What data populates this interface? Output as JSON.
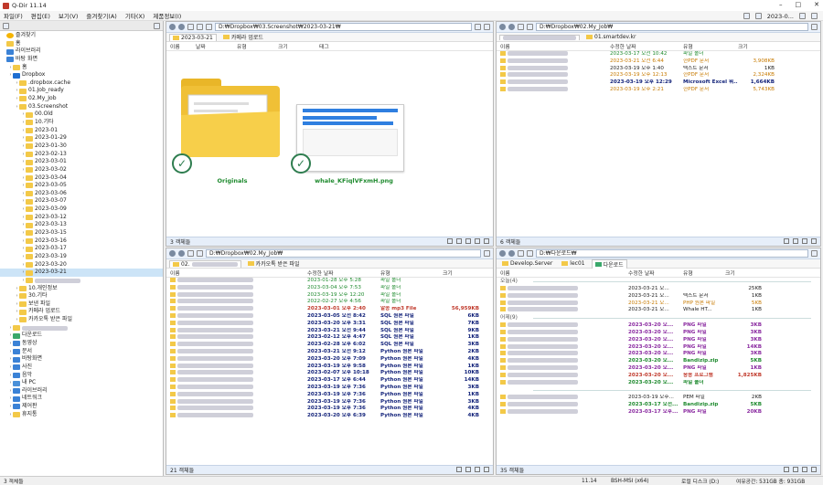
{
  "app": {
    "title": "Q-Dir 11.14"
  },
  "menu": [
    "파일(F)",
    "편집(E)",
    "보기(V)",
    "즐겨찾기(A)",
    "기타(X)",
    "제품정보(I)"
  ],
  "menu_right": {
    "date_label": "2023-0..."
  },
  "tree": [
    {
      "label": "즐겨찾기",
      "indent": 0,
      "icon": "star"
    },
    {
      "label": "홈",
      "indent": 0,
      "icon": "folder"
    },
    {
      "label": "라이브러리",
      "indent": 0,
      "icon": "blue"
    },
    {
      "label": "바탕 화면",
      "indent": 0,
      "icon": "blue"
    },
    {
      "label": "홈",
      "indent": 1,
      "icon": "folder"
    },
    {
      "label": "Dropbox",
      "indent": 1,
      "icon": "drop"
    },
    {
      "label": ".dropbox.cache",
      "indent": 2,
      "icon": "folder"
    },
    {
      "label": "01.Job_ready",
      "indent": 2,
      "icon": "folder"
    },
    {
      "label": "02.My_Job",
      "indent": 2,
      "icon": "folder"
    },
    {
      "label": "03.Screenshot",
      "indent": 2,
      "icon": "folder"
    },
    {
      "label": "00.Old",
      "indent": 3,
      "icon": "folder"
    },
    {
      "label": "10.기타",
      "indent": 3,
      "icon": "folder"
    },
    {
      "label": "2023-01",
      "indent": 3,
      "icon": "folder"
    },
    {
      "label": "2023-01-29",
      "indent": 3,
      "icon": "folder"
    },
    {
      "label": "2023-01-30",
      "indent": 3,
      "icon": "folder"
    },
    {
      "label": "2023-02-13",
      "indent": 3,
      "icon": "folder"
    },
    {
      "label": "2023-03-01",
      "indent": 3,
      "icon": "folder"
    },
    {
      "label": "2023-03-02",
      "indent": 3,
      "icon": "folder"
    },
    {
      "label": "2023-03-04",
      "indent": 3,
      "icon": "folder"
    },
    {
      "label": "2023-03-05",
      "indent": 3,
      "icon": "folder"
    },
    {
      "label": "2023-03-06",
      "indent": 3,
      "icon": "folder"
    },
    {
      "label": "2023-03-07",
      "indent": 3,
      "icon": "folder"
    },
    {
      "label": "2023-03-09",
      "indent": 3,
      "icon": "folder"
    },
    {
      "label": "2023-03-12",
      "indent": 3,
      "icon": "folder"
    },
    {
      "label": "2023-03-13",
      "indent": 3,
      "icon": "folder"
    },
    {
      "label": "2023-03-15",
      "indent": 3,
      "icon": "folder"
    },
    {
      "label": "2023-03-16",
      "indent": 3,
      "icon": "folder"
    },
    {
      "label": "2023-03-17",
      "indent": 3,
      "icon": "folder"
    },
    {
      "label": "2023-03-19",
      "indent": 3,
      "icon": "folder"
    },
    {
      "label": "2023-03-20",
      "indent": 3,
      "icon": "folder"
    },
    {
      "label": "2023-03-21",
      "indent": 3,
      "icon": "folder",
      "selected": true
    },
    {
      "label": "",
      "indent": 3,
      "icon": "folder"
    },
    {
      "label": "10.개인정보",
      "indent": 2,
      "icon": "folder"
    },
    {
      "label": "30.기타",
      "indent": 2,
      "icon": "folder"
    },
    {
      "label": "보낸 파일",
      "indent": 2,
      "icon": "folder"
    },
    {
      "label": "카메라 업로드",
      "indent": 2,
      "icon": "folder"
    },
    {
      "label": "카카오톡 받은 파일",
      "indent": 2,
      "icon": "folder"
    },
    {
      "label": "",
      "indent": 1,
      "icon": "folder"
    },
    {
      "label": "다운로드",
      "indent": 1,
      "icon": "green"
    },
    {
      "label": "동영상",
      "indent": 1,
      "icon": "blue"
    },
    {
      "label": "문서",
      "indent": 1,
      "icon": "blue"
    },
    {
      "label": "바탕화면",
      "indent": 1,
      "icon": "blue"
    },
    {
      "label": "사진",
      "indent": 1,
      "icon": "blue"
    },
    {
      "label": "음악",
      "indent": 1,
      "icon": "blue"
    },
    {
      "label": "내 PC",
      "indent": 1,
      "icon": "pc"
    },
    {
      "label": "라이브러리",
      "indent": 1,
      "icon": "blue"
    },
    {
      "label": "네트워크",
      "indent": 1,
      "icon": "blue"
    },
    {
      "label": "제어판",
      "indent": 1,
      "icon": "blue"
    },
    {
      "label": "휴지통",
      "indent": 1,
      "icon": "folder"
    }
  ],
  "pane_tl": {
    "path": "D:₩Dropbox₩03.Screenshot₩2023-03-21₩",
    "tabs": [
      "2023-03-21",
      "카메라 업로드"
    ],
    "columns": [
      "이름",
      "날짜",
      "유형",
      "크기",
      "태그"
    ],
    "items": [
      {
        "name": "Originals"
      },
      {
        "name": "whale_KFiqlVFxmH.png"
      }
    ],
    "status": "3 객체들"
  },
  "pane_tr": {
    "path": "D:₩Dropbox₩02.My_Job₩",
    "tabs": [
      "",
      "01.smartdev.kr"
    ],
    "columns": [
      "이름",
      "수정한 날짜",
      "유형",
      "크기"
    ],
    "rows": [
      {
        "date": "2023-03-17 오전 10:42",
        "type": "파일 폴더",
        "size": "",
        "cls": "green"
      },
      {
        "date": "2023-03-21 오전 6:44",
        "type": "한PDF 문서",
        "size": "3,908KB",
        "cls": "orange"
      },
      {
        "date": "2023-03-19 오후 1:40",
        "type": "텍스트 문서",
        "size": "1KB",
        "cls": ""
      },
      {
        "date": "2023-03-19 오후 12:13",
        "type": "한PDF 문서",
        "size": "2,324KB",
        "cls": "orange"
      },
      {
        "date": "2023-03-19 오후 12:29",
        "type": "Microsoft Excel 워...",
        "size": "1,664KB",
        "cls": "navy"
      },
      {
        "date": "2023-03-19 오후 2:21",
        "type": "한PDF 문서",
        "size": "5,743KB",
        "cls": "orange"
      }
    ],
    "status": "6 객체들"
  },
  "pane_bl": {
    "path": "D:₩Dropbox₩02.My_Job₩",
    "tabs": [
      "02.",
      "카카오톡 받은 파일"
    ],
    "columns": [
      "이름",
      "수정한 날짜",
      "유형",
      "크기"
    ],
    "rows": [
      {
        "date": "2023-01-28 오후 5:28",
        "type": "파일 폴더",
        "size": "",
        "cls": "green"
      },
      {
        "date": "2023-03-04 오후 7:53",
        "type": "파일 폴더",
        "size": "",
        "cls": "green"
      },
      {
        "date": "2023-03-19 오후 12:20",
        "type": "파일 폴더",
        "size": "",
        "cls": "green"
      },
      {
        "date": "2022-02-27 오후 4:56",
        "type": "파일 폴더",
        "size": "",
        "cls": "green"
      },
      {
        "date": "2023-03-01 오후 2:40",
        "type": "알송 mp3 File",
        "size": "56,959KB",
        "cls": "red"
      },
      {
        "date": "2023-03-05 오전 8:42",
        "type": "SQL 원본 파일",
        "size": "6KB",
        "cls": "navy"
      },
      {
        "date": "2023-03-20 오후 3:31",
        "type": "SQL 원본 파일",
        "size": "7KB",
        "cls": "navy"
      },
      {
        "date": "2023-03-21 오전 9:44",
        "type": "SQL 원본 파일",
        "size": "9KB",
        "cls": "navy"
      },
      {
        "date": "2023-02-12 오후 4:47",
        "type": "SQL 원본 파일",
        "size": "1KB",
        "cls": "navy"
      },
      {
        "date": "2023-02-28 오후 6:02",
        "type": "SQL 원본 파일",
        "size": "3KB",
        "cls": "navy"
      },
      {
        "date": "2023-03-21 오전 9:12",
        "type": "Python 원본 파일",
        "size": "2KB",
        "cls": "navy"
      },
      {
        "date": "2023-03-20 오후 7:09",
        "type": "Python 원본 파일",
        "size": "4KB",
        "cls": "navy"
      },
      {
        "date": "2023-03-19 오후 9:58",
        "type": "Python 원본 파일",
        "size": "1KB",
        "cls": "navy"
      },
      {
        "date": "2023-02-07 오후 10:18",
        "type": "Python 원본 파일",
        "size": "10KB",
        "cls": "navy"
      },
      {
        "date": "2023-03-17 오후 6:44",
        "type": "Python 원본 파일",
        "size": "14KB",
        "cls": "navy"
      },
      {
        "date": "2023-03-19 오후 7:36",
        "type": "Python 원본 파일",
        "size": "3KB",
        "cls": "navy"
      },
      {
        "date": "2023-03-19 오후 7:36",
        "type": "Python 원본 파일",
        "size": "1KB",
        "cls": "navy"
      },
      {
        "date": "2023-03-19 오후 7:36",
        "type": "Python 원본 파일",
        "size": "3KB",
        "cls": "navy"
      },
      {
        "date": "2023-03-19 오후 7:36",
        "type": "Python 원본 파일",
        "size": "4KB",
        "cls": "navy"
      },
      {
        "date": "2023-03-20 오후 6:39",
        "type": "Python 원본 파일",
        "size": "4KB",
        "cls": "navy"
      }
    ],
    "status": "21 객체들"
  },
  "pane_br": {
    "path": "D:₩다운로드₩",
    "tabs": [
      "Develop.Server",
      "lec01",
      "다운로드"
    ],
    "columns": [
      "이름",
      "수정한 날짜",
      "유형",
      "크기"
    ],
    "group_today": "오늘(4)",
    "group_yesterday": "어제(9)",
    "rows_today": [
      {
        "date": "2023-03-21 오...",
        "type": "",
        "size": "25KB",
        "cls": ""
      },
      {
        "date": "2023-03-21 오...",
        "type": "텍스트 문서",
        "size": "1KB",
        "cls": ""
      },
      {
        "date": "2023-03-21 오...",
        "type": "PHP 원본 파일",
        "size": "5KB",
        "cls": "orange"
      },
      {
        "date": "2023-03-21 오...",
        "type": "Whale HT...",
        "size": "1KB",
        "cls": ""
      }
    ],
    "rows_yesterday": [
      {
        "date": "2023-03-20 오...",
        "type": "PNG 파일",
        "size": "3KB",
        "cls": "purple"
      },
      {
        "date": "2023-03-20 오...",
        "type": "PNG 파일",
        "size": "3KB",
        "cls": "purple"
      },
      {
        "date": "2023-03-20 오...",
        "type": "PNG 파일",
        "size": "3KB",
        "cls": "purple"
      },
      {
        "date": "2023-03-20 오...",
        "type": "PNG 파일",
        "size": "14KB",
        "cls": "purple"
      },
      {
        "date": "2023-03-20 오...",
        "type": "PNG 파일",
        "size": "3KB",
        "cls": "purple"
      },
      {
        "date": "2023-03-20 오...",
        "type": "Bandizip.zip",
        "size": "5KB",
        "cls": "bold-green"
      },
      {
        "date": "2023-03-20 오...",
        "type": "PNG 파일",
        "size": "1KB",
        "cls": "purple"
      },
      {
        "date": "2023-03-20 오...",
        "type": "응용 프로그램",
        "size": "1,825KB",
        "cls": "red"
      },
      {
        "date": "2023-03-20 오...",
        "type": "파일 폴더",
        "size": "",
        "cls": "bold-green"
      }
    ],
    "rows_more": [
      {
        "date": "2023-03-19 오후...",
        "type": "PEM 파일",
        "size": "2KB",
        "cls": ""
      },
      {
        "date": "2023-03-17 오전...",
        "type": "Bandizip.zip",
        "size": "5KB",
        "cls": "bold-green"
      },
      {
        "date": "2023-03-17 오후...",
        "type": "PNG 파일",
        "size": "20KB",
        "cls": "purple"
      }
    ],
    "status": "35 객체들"
  },
  "status": {
    "left": "3 객체들",
    "version": "11.14",
    "machine": "BSH-MSI (x64)",
    "drive": "로컬 디스크 (D:)",
    "space": "여유공간: 531GB 총: 931GB"
  }
}
